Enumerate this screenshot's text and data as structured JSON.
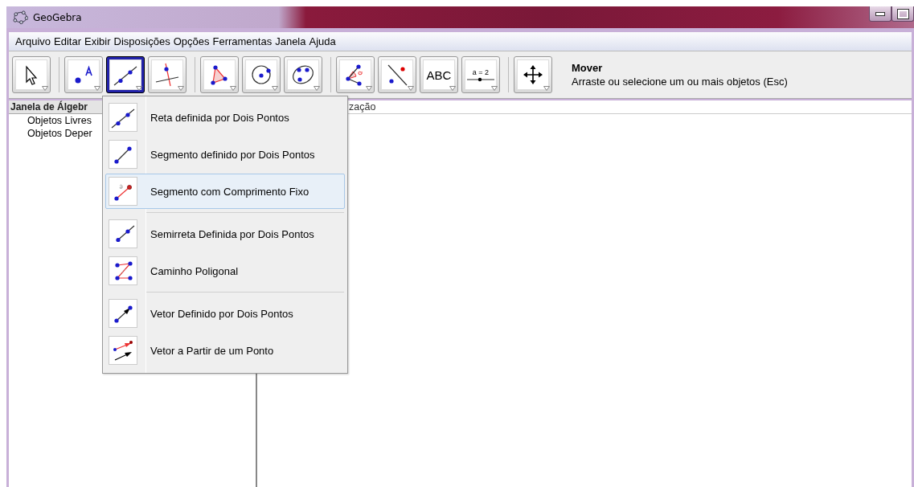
{
  "window": {
    "title": "GeoGebra"
  },
  "menu_bar": [
    "Arquivo",
    "Editar",
    "Exibir",
    "Disposições",
    "Opções",
    "Ferramentas",
    "Janela",
    "Ajuda"
  ],
  "toolbar": {
    "groups": [
      [
        {
          "kind": "pointer",
          "selected": false
        }
      ],
      [
        {
          "kind": "point",
          "selected": false
        },
        {
          "kind": "line",
          "selected": true
        },
        {
          "kind": "perpendicular",
          "selected": false
        }
      ],
      [
        {
          "kind": "polygon",
          "selected": false
        },
        {
          "kind": "circle",
          "selected": false
        },
        {
          "kind": "conic",
          "selected": false
        }
      ],
      [
        {
          "kind": "angle",
          "selected": false
        },
        {
          "kind": "reflect",
          "selected": false
        },
        {
          "kind": "text",
          "label": "ABC",
          "selected": false
        },
        {
          "kind": "slider",
          "label": "a = 2",
          "selected": false
        }
      ],
      [
        {
          "kind": "move",
          "selected": false
        }
      ]
    ],
    "tool_title": "Mover",
    "tool_help": "Arraste ou selecione um ou mais objetos (Esc)"
  },
  "algebra_panel": {
    "header": "Janela de Álgebr",
    "items": [
      "Objetos Livres",
      "Objetos Deper"
    ]
  },
  "graphics_panel": {
    "header": "zação"
  },
  "dropdown": {
    "groups": [
      [
        {
          "kind": "line",
          "label": "Reta definida por Dois Pontos",
          "selected": false
        },
        {
          "kind": "segment",
          "label": "Segmento definido por Dois Pontos",
          "selected": false
        },
        {
          "kind": "fixed-segment",
          "label": "Segmento com Comprimento Fixo",
          "selected": true
        }
      ],
      [
        {
          "kind": "ray",
          "label": "Semirreta Definida por Dois Pontos",
          "selected": false
        },
        {
          "kind": "polyline",
          "label": "Caminho Poligonal",
          "selected": false
        }
      ],
      [
        {
          "kind": "vector",
          "label": "Vetor Definido por Dois Pontos",
          "selected": false
        },
        {
          "kind": "vector-from-point",
          "label": "Vetor a Partir de um Ponto",
          "selected": false
        }
      ]
    ]
  }
}
